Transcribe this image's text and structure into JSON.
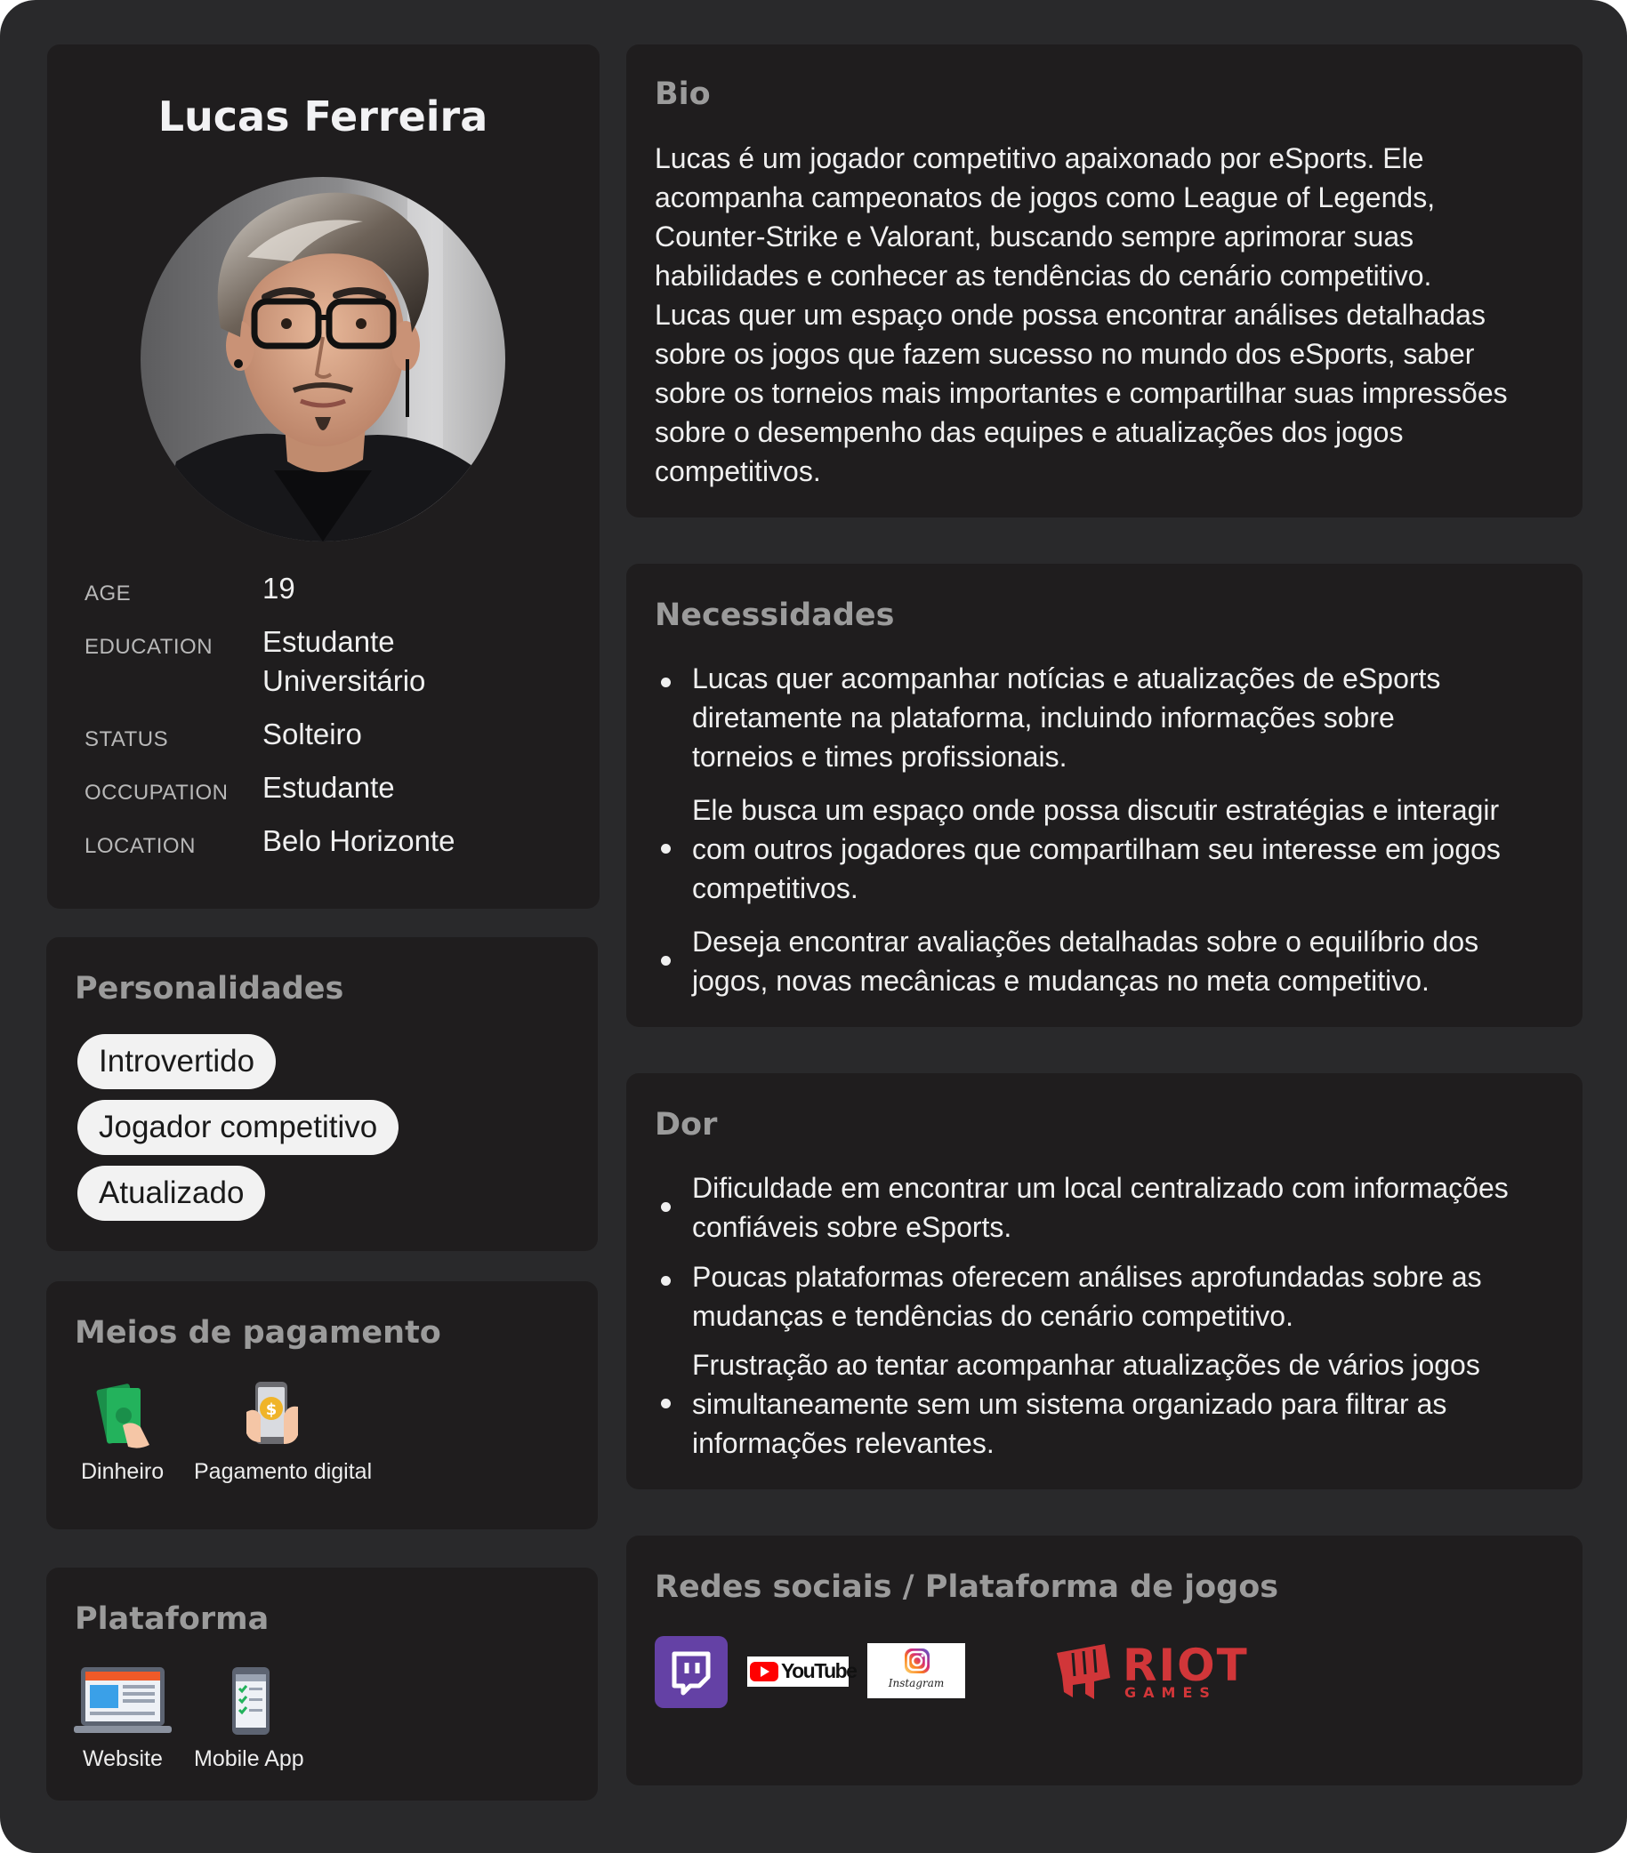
{
  "profile": {
    "name": "Lucas Ferreira",
    "fields": [
      {
        "label": "AGE",
        "value": "19"
      },
      {
        "label": "EDUCATION",
        "value": "Estudante Universitário"
      },
      {
        "label": "STATUS",
        "value": "Solteiro"
      },
      {
        "label": "OCCUPATION",
        "value": "Estudante"
      },
      {
        "label": "LOCATION",
        "value": "Belo Horizonte"
      }
    ]
  },
  "personalities": {
    "title": "Personalidades",
    "tags": [
      "Introvertido",
      "Jogador competitivo",
      "Atualizado"
    ]
  },
  "payment": {
    "title": "Meios de pagamento",
    "items": [
      {
        "label": "Dinheiro",
        "icon": "cash-icon"
      },
      {
        "label": "Pagamento digital",
        "icon": "digital-payment-icon"
      }
    ]
  },
  "platform": {
    "title": "Plataforma",
    "items": [
      {
        "label": "Website",
        "icon": "laptop-icon"
      },
      {
        "label": "Mobile App",
        "icon": "smartphone-icon"
      }
    ]
  },
  "bio": {
    "title": "Bio",
    "lines": [
      "Lucas é um jogador competitivo apaixonado por eSports. Ele",
      "acompanha campeonatos de jogos como League of Legends,",
      "Counter-Strike e Valorant, buscando sempre aprimorar suas",
      "habilidades e conhecer as tendências do cenário competitivo.",
      "Lucas quer um espaço onde possa encontrar análises detalhadas",
      "sobre os jogos que fazem sucesso no mundo dos eSports, saber",
      "sobre os torneios mais importantes e compartilhar suas impressões",
      "sobre o desempenho das equipes e atualizações dos jogos",
      "competitivos."
    ]
  },
  "needs": {
    "title": "Necessidades",
    "items": [
      [
        "Lucas quer acompanhar notícias e atualizações de eSports",
        "diretamente na plataforma, incluindo informações sobre",
        "torneios e times profissionais."
      ],
      [
        "Ele busca um espaço onde possa discutir estratégias e interagir",
        "com outros jogadores que compartilham seu interesse em jogos",
        "competitivos."
      ],
      [
        "Deseja encontrar avaliações detalhadas sobre o equilíbrio dos",
        "jogos, novas mecânicas e mudanças no meta competitivo."
      ]
    ]
  },
  "pain": {
    "title": "Dor",
    "items": [
      [
        "Dificuldade em encontrar um local centralizado com informações",
        "confiáveis sobre eSports."
      ],
      [
        "Poucas plataformas oferecem análises aprofundadas sobre as",
        "mudanças e tendências do cenário competitivo."
      ],
      [
        "Frustração ao tentar acompanhar atualizações de vários jogos",
        "simultaneamente sem um sistema organizado para filtrar as",
        "informações relevantes."
      ]
    ]
  },
  "social": {
    "title": "Redes sociais / Plataforma de jogos",
    "logos": [
      {
        "name": "twitch-logo"
      },
      {
        "name": "youtube-logo",
        "text": "YouTube"
      },
      {
        "name": "instagram-logo",
        "text": "Instagram"
      },
      {
        "name": "riot-games-logo",
        "text": "RIOT",
        "subtext": "GAMES"
      }
    ],
    "colors": {
      "twitch": "#6441a5",
      "youtube": "#ff0000",
      "riot": "#d13639"
    }
  }
}
